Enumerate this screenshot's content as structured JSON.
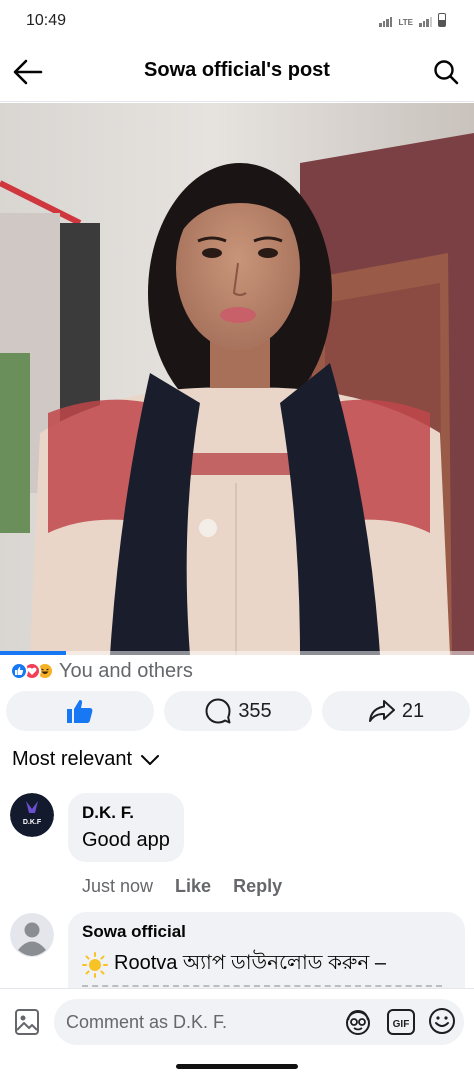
{
  "status_bar": {
    "time": "10:49",
    "network": "LTE"
  },
  "header": {
    "title": "Sowa official's post"
  },
  "video": {
    "progress": 0.14,
    "alt": "video frame"
  },
  "reactions": {
    "text": "You and others",
    "types": [
      "like-icon",
      "love-icon",
      "haha-icon"
    ]
  },
  "actions": {
    "comment_count": "355",
    "share_count": "21"
  },
  "sort": {
    "label": "Most relevant"
  },
  "comments": [
    {
      "author": "D.K. F.",
      "avatar_text": "D.K.F",
      "text": "Good app",
      "time": "Just now",
      "like_label": "Like",
      "reply_label": "Reply"
    },
    {
      "author": "Sowa official",
      "text": "Rootva অ্যাপ ডাউনলোড করুন –"
    }
  ],
  "composer": {
    "placeholder": "Comment as D.K. F."
  },
  "colors": {
    "accent": "#1877f2",
    "bubble": "#f0f2f5",
    "secondary_text": "#65676b"
  }
}
